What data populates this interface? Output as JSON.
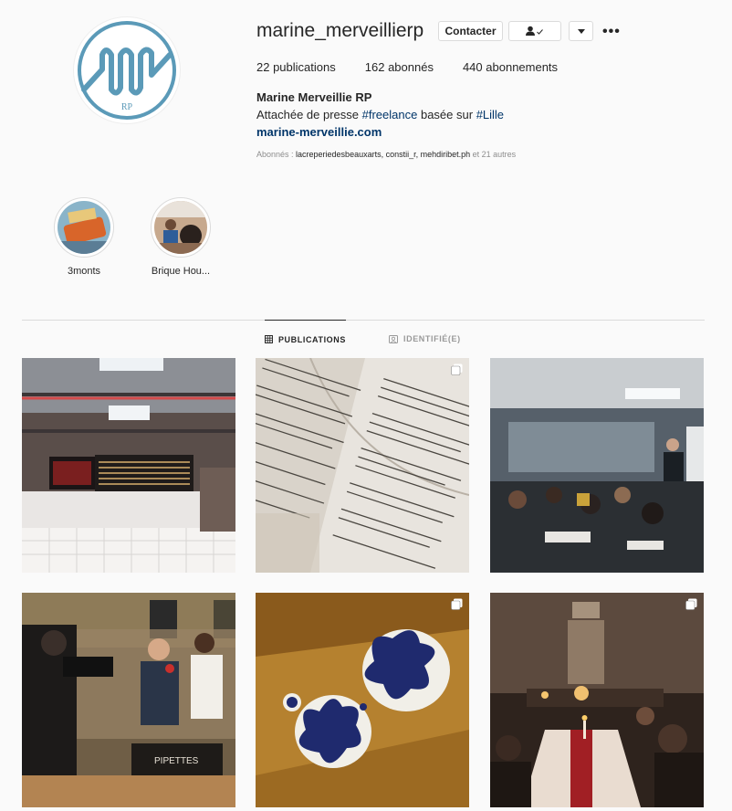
{
  "profile": {
    "username": "marine_merveillierp",
    "full_name": "Marine Merveillie RP",
    "bio_prefix": "Attachée de presse ",
    "bio_tag1": "#freelance",
    "bio_mid": " basée sur ",
    "bio_tag2": "#Lille",
    "website": "marine-merveillie.com",
    "followed_by_label": "Abonnés : ",
    "followed_by_names": "lacreperiedesbeauxarts, constii_r, mehdiribet.ph",
    "followed_by_more": " et 21 autres"
  },
  "buttons": {
    "contact": "Contacter",
    "more": "•••"
  },
  "stats": {
    "posts_count": "22",
    "posts_label": " publications",
    "followers_count": "162",
    "followers_label": " abonnés",
    "following_count": "440",
    "following_label": " abonnements"
  },
  "highlights": [
    {
      "label": "3monts"
    },
    {
      "label": "Brique Hou..."
    }
  ],
  "tabs": {
    "publications": "PUBLICATIONS",
    "tagged": "IDENTIFIÉ(E)"
  },
  "posts": [
    {
      "icon": "brewery-taproom-photo",
      "multi": false
    },
    {
      "icon": "old-directory-page-photo",
      "multi": true
    },
    {
      "icon": "meeting-room-photo",
      "multi": false
    },
    {
      "icon": "tv-interview-photo",
      "multi": false
    },
    {
      "icon": "ink-splash-plates-photo",
      "multi": true
    },
    {
      "icon": "candlelit-dinner-photo",
      "multi": true
    }
  ],
  "colors": {
    "logo_blue": "#5b9ab8",
    "link": "#003569",
    "secondary_text": "#8e8e8e",
    "border": "#dbdbdb"
  }
}
